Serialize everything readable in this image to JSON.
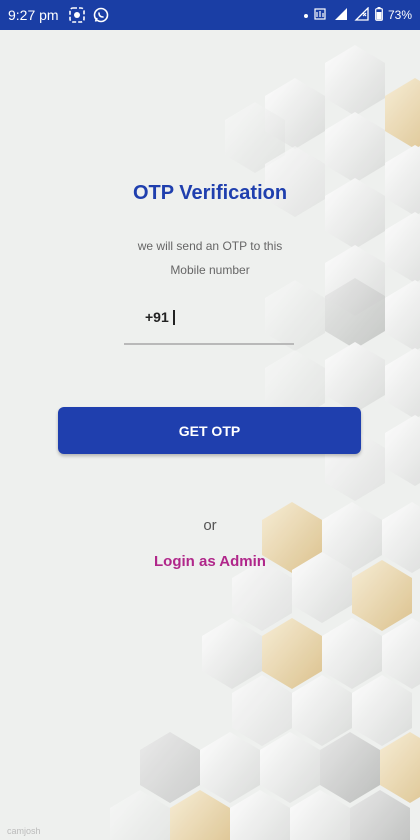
{
  "status_bar": {
    "time": "9:27 pm",
    "battery": "73%",
    "icons": [
      "screen-record-icon",
      "whatsapp-icon",
      "dot-icon",
      "volte-icon",
      "signal-4g-icon",
      "signal-icon",
      "battery-icon"
    ]
  },
  "screen": {
    "title": "OTP Verification",
    "subtitle_line1": "we will send an OTP to this",
    "subtitle_line2": "Mobile number",
    "phone_prefix": "+91",
    "get_otp_label": "GET OTP",
    "or_label": "or",
    "admin_login_label": "Login as Admin"
  },
  "colors": {
    "primary": "#1f3fae",
    "status_bar": "#1a3ea5",
    "accent_link": "#b0278a",
    "background": "#eef0ee",
    "hex_gold": "#e6d3a6"
  },
  "watermark": "camjosh"
}
